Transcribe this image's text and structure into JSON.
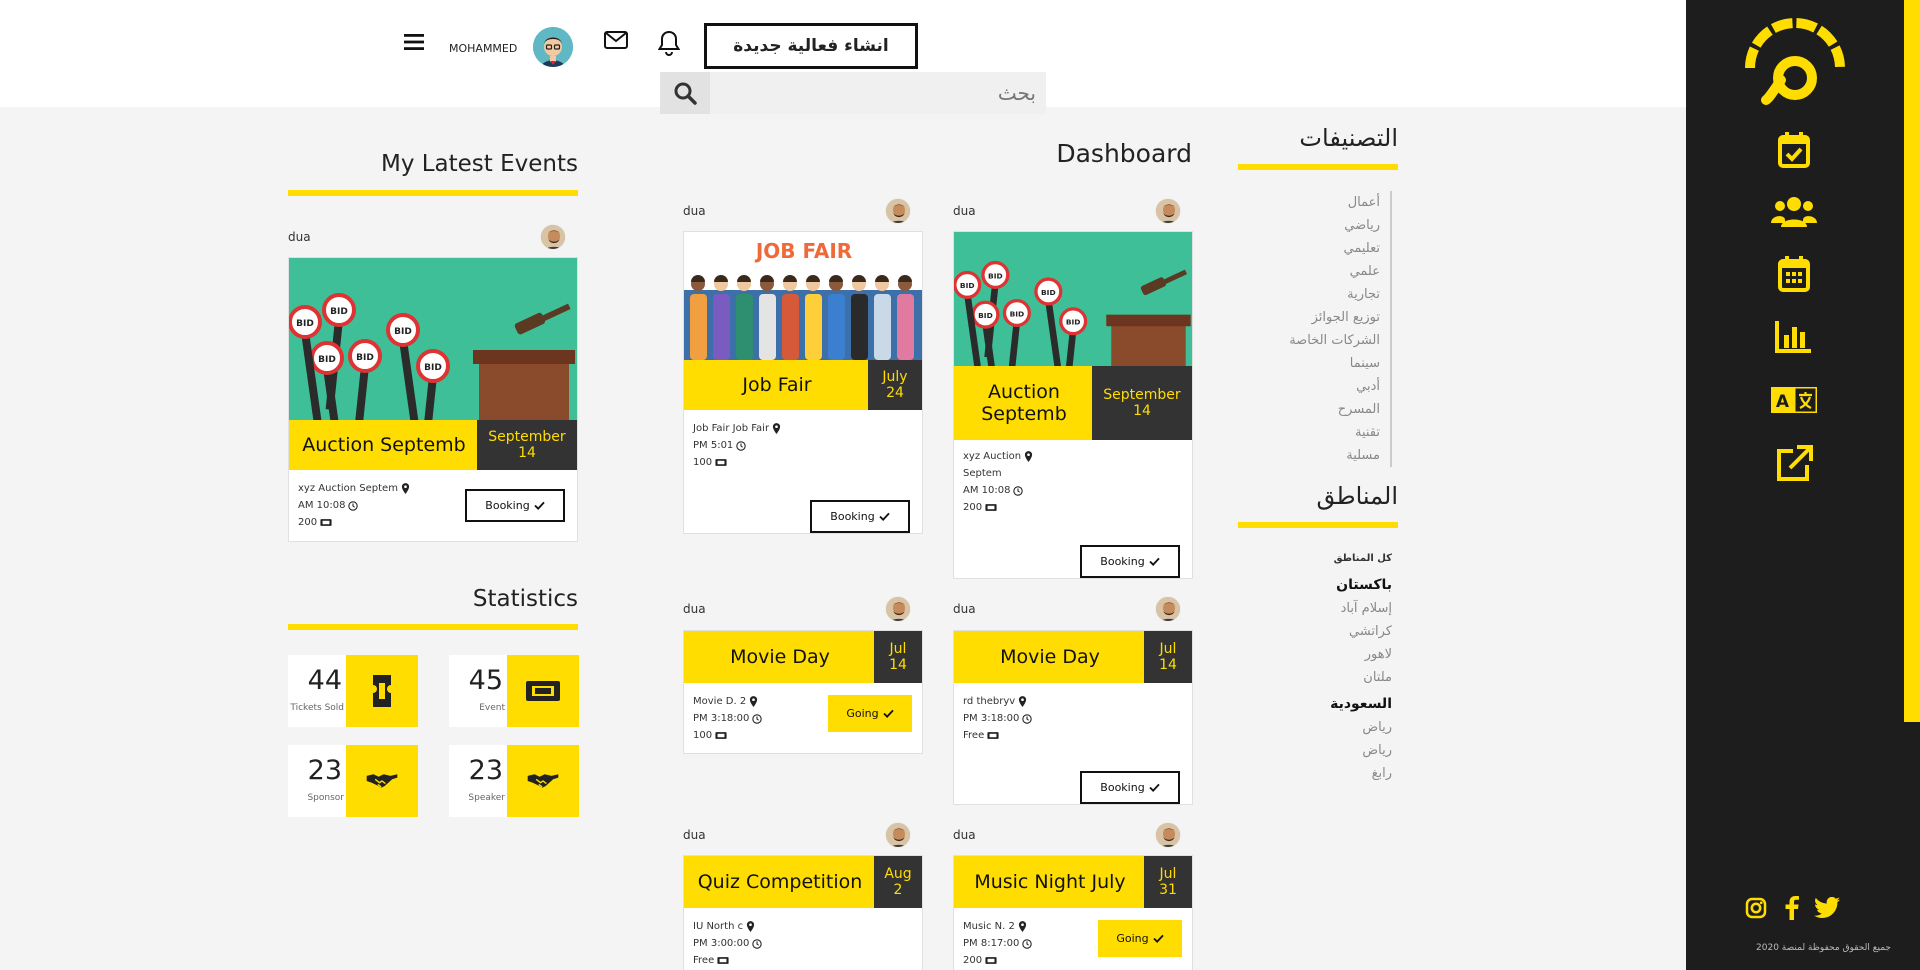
{
  "header": {
    "create_event": "انشاء فعالية جديدة",
    "username": "MOHAMMED",
    "search_placeholder": "بحث"
  },
  "sidebar": {
    "nav": [
      "calendar-check-icon",
      "users-icon",
      "calendar-grid-icon",
      "bar-chart-icon",
      "translate-icon",
      "external-link-icon"
    ],
    "social": [
      "instagram-icon",
      "facebook-icon",
      "twitter-icon"
    ],
    "copyright": "جميع الحقوق محفوظة لمنصة 2020"
  },
  "latest": {
    "title": "My Latest Events",
    "card": {
      "user": "dua",
      "name": "Auction Septemb",
      "date_month": "September",
      "date_day": "14",
      "location": "xyz Auction Septem",
      "time": "AM 10:08",
      "price": "200",
      "action": "Booking"
    }
  },
  "statistics": {
    "title": "Statistics",
    "items": [
      {
        "value": "45",
        "label": "Event"
      },
      {
        "value": "44",
        "label": "Tickets Sold"
      },
      {
        "value": "23",
        "label": "Speaker"
      },
      {
        "value": "23",
        "label": "Sponsor"
      }
    ]
  },
  "dashboard": {
    "title": "Dashboard",
    "events": [
      {
        "user": "dua",
        "name": "Job Fair",
        "date_month": "July",
        "date_day": "24",
        "location": "Job Fair Job Fair",
        "time": "PM 5:01",
        "price": "100",
        "action": "Booking"
      },
      {
        "user": "dua",
        "name_l1": "Auction",
        "name_l2": "Septemb",
        "date_month": "September",
        "date_day": "14",
        "location_l1": "xyz Auction",
        "location_l2": "Septem",
        "time": "AM 10:08",
        "price": "200",
        "action": "Booking"
      },
      {
        "user": "dua",
        "name": "Movie Day",
        "date_month": "Jul",
        "date_day": "14",
        "location": "Movie D. 2",
        "time": "PM 3:18:00",
        "price": "100",
        "action": "Going"
      },
      {
        "user": "dua",
        "name": "Movie Day",
        "date_month": "Jul",
        "date_day": "14",
        "location": "rd thebryv",
        "time": "PM 3:18:00",
        "price": "Free",
        "action": "Booking"
      },
      {
        "user": "dua",
        "name": "Quiz Competition",
        "date_month": "Aug",
        "date_day": "2",
        "location": "IU North c",
        "time": "PM 3:00:00",
        "price": "Free"
      },
      {
        "user": "dua",
        "name": "Music Night July",
        "date_month": "Jul",
        "date_day": "31",
        "location": "Music N. 2",
        "time": "PM 8:17:00",
        "price": "200",
        "action": "Going"
      }
    ],
    "job_fair_banner": "JOB FAIR",
    "bid_label": "BID"
  },
  "categories": {
    "title": "التصنيفات",
    "items": [
      "أعمال",
      "رياضي",
      "تعليمي",
      "علمي",
      "تجارية",
      "توزيع الجوائز",
      "الشركات الخاصة",
      "سينما",
      "أدبي",
      "المسرح",
      "تقنية",
      "مسلية"
    ]
  },
  "regions": {
    "title": "المناطق",
    "all": "كل المناطق",
    "country1": "باكستان",
    "country1_cities": [
      "إسلام آباد",
      "كراتشي",
      "لاهور",
      "ملتان"
    ],
    "country2": "السعودية",
    "country2_cities": [
      "رياض",
      "رياض",
      "رابغ"
    ]
  },
  "colors": {
    "accent": "#ffdd00",
    "dark": "#1d1d1d",
    "date_bg": "#333333"
  }
}
